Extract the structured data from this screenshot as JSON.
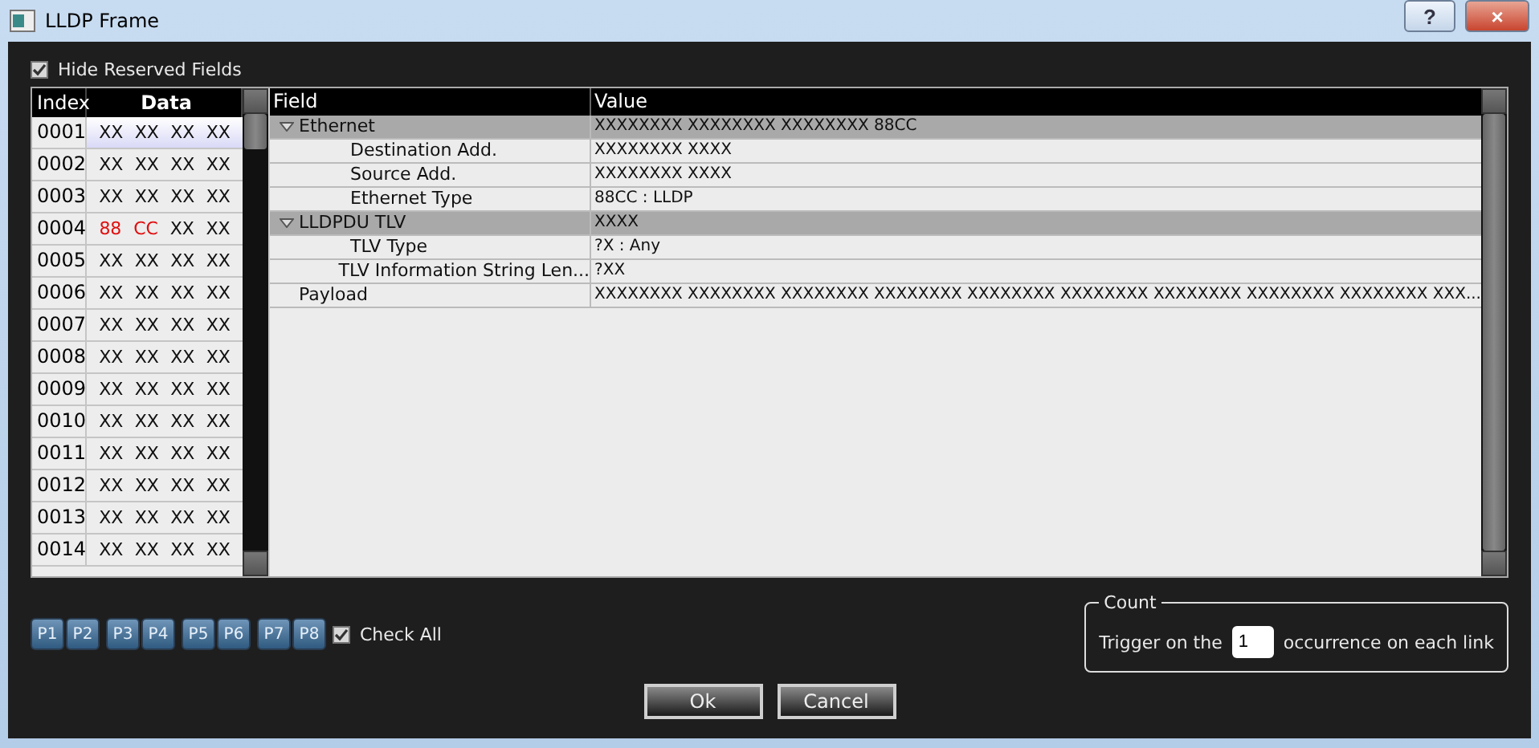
{
  "window": {
    "title": "LLDP Frame",
    "buttons": [
      "?",
      "×"
    ]
  },
  "hide_reserved": {
    "label": "Hide Reserved Fields",
    "checked": true
  },
  "data_table": {
    "columns": [
      "Index",
      "Data"
    ],
    "rows": [
      {
        "index": "0001",
        "selected": true,
        "cells": [
          {
            "text": "XX",
            "highlighted": false
          },
          {
            "text": "XX",
            "highlighted": false
          },
          {
            "text": "XX",
            "highlighted": false
          },
          {
            "text": "XX",
            "highlighted": false
          }
        ]
      },
      {
        "index": "0002",
        "selected": false,
        "cells": [
          {
            "text": "XX",
            "highlighted": false
          },
          {
            "text": "XX",
            "highlighted": false
          },
          {
            "text": "XX",
            "highlighted": false
          },
          {
            "text": "XX",
            "highlighted": false
          }
        ]
      },
      {
        "index": "0003",
        "selected": false,
        "cells": [
          {
            "text": "XX",
            "highlighted": false
          },
          {
            "text": "XX",
            "highlighted": false
          },
          {
            "text": "XX",
            "highlighted": false
          },
          {
            "text": "XX",
            "highlighted": false
          }
        ]
      },
      {
        "index": "0004",
        "selected": false,
        "cells": [
          {
            "text": "88",
            "highlighted": true
          },
          {
            "text": "CC",
            "highlighted": true
          },
          {
            "text": "XX",
            "highlighted": false
          },
          {
            "text": "XX",
            "highlighted": false
          }
        ]
      },
      {
        "index": "0005",
        "selected": false,
        "cells": [
          {
            "text": "XX",
            "highlighted": false
          },
          {
            "text": "XX",
            "highlighted": false
          },
          {
            "text": "XX",
            "highlighted": false
          },
          {
            "text": "XX",
            "highlighted": false
          }
        ]
      },
      {
        "index": "0006",
        "selected": false,
        "cells": [
          {
            "text": "XX",
            "highlighted": false
          },
          {
            "text": "XX",
            "highlighted": false
          },
          {
            "text": "XX",
            "highlighted": false
          },
          {
            "text": "XX",
            "highlighted": false
          }
        ]
      },
      {
        "index": "0007",
        "selected": false,
        "cells": [
          {
            "text": "XX",
            "highlighted": false
          },
          {
            "text": "XX",
            "highlighted": false
          },
          {
            "text": "XX",
            "highlighted": false
          },
          {
            "text": "XX",
            "highlighted": false
          }
        ]
      },
      {
        "index": "0008",
        "selected": false,
        "cells": [
          {
            "text": "XX",
            "highlighted": false
          },
          {
            "text": "XX",
            "highlighted": false
          },
          {
            "text": "XX",
            "highlighted": false
          },
          {
            "text": "XX",
            "highlighted": false
          }
        ]
      },
      {
        "index": "0009",
        "selected": false,
        "cells": [
          {
            "text": "XX",
            "highlighted": false
          },
          {
            "text": "XX",
            "highlighted": false
          },
          {
            "text": "XX",
            "highlighted": false
          },
          {
            "text": "XX",
            "highlighted": false
          }
        ]
      },
      {
        "index": "0010",
        "selected": false,
        "cells": [
          {
            "text": "XX",
            "highlighted": false
          },
          {
            "text": "XX",
            "highlighted": false
          },
          {
            "text": "XX",
            "highlighted": false
          },
          {
            "text": "XX",
            "highlighted": false
          }
        ]
      },
      {
        "index": "0011",
        "selected": false,
        "cells": [
          {
            "text": "XX",
            "highlighted": false
          },
          {
            "text": "XX",
            "highlighted": false
          },
          {
            "text": "XX",
            "highlighted": false
          },
          {
            "text": "XX",
            "highlighted": false
          }
        ]
      },
      {
        "index": "0012",
        "selected": false,
        "cells": [
          {
            "text": "XX",
            "highlighted": false
          },
          {
            "text": "XX",
            "highlighted": false
          },
          {
            "text": "XX",
            "highlighted": false
          },
          {
            "text": "XX",
            "highlighted": false
          }
        ]
      },
      {
        "index": "0013",
        "selected": false,
        "cells": [
          {
            "text": "XX",
            "highlighted": false
          },
          {
            "text": "XX",
            "highlighted": false
          },
          {
            "text": "XX",
            "highlighted": false
          },
          {
            "text": "XX",
            "highlighted": false
          }
        ]
      },
      {
        "index": "0014",
        "selected": false,
        "cells": [
          {
            "text": "XX",
            "highlighted": false
          },
          {
            "text": "XX",
            "highlighted": false
          },
          {
            "text": "XX",
            "highlighted": false
          },
          {
            "text": "XX",
            "highlighted": false
          }
        ]
      }
    ]
  },
  "field_tree": {
    "columns": [
      "Field",
      "Value"
    ],
    "nodes": [
      {
        "field": "Ethernet",
        "value": "XXXXXXXX XXXXXXXX XXXXXXXX 88CC",
        "expanded": true,
        "children": [
          {
            "field": "Destination Add.",
            "value": "XXXXXXXX XXXX"
          },
          {
            "field": "Source Add.",
            "value": "XXXXXXXX XXXX"
          },
          {
            "field": "Ethernet Type",
            "value": "88CC : LLDP"
          }
        ]
      },
      {
        "field": "LLDPDU TLV",
        "value": "XXXX",
        "expanded": true,
        "children": [
          {
            "field": "TLV Type",
            "value": "?X : Any"
          },
          {
            "field": "TLV Information String Len...",
            "value": "?XX"
          }
        ]
      },
      {
        "field": "Payload",
        "value": "XXXXXXXX XXXXXXXX XXXXXXXX XXXXXXXX XXXXXXXX XXXXXXXX XXXXXXXX XXXXXXXX XXXXXXXX XXX..."
      }
    ]
  },
  "ports": [
    [
      "P1",
      "P2"
    ],
    [
      "P3",
      "P4"
    ],
    [
      "P5",
      "P6"
    ],
    [
      "P7",
      "P8"
    ]
  ],
  "check_all": {
    "label": "Check All",
    "checked": true
  },
  "count": {
    "title": "Count",
    "prefix": "Trigger on the",
    "value": "1",
    "suffix": "occurrence on each link"
  },
  "buttons": [
    "Ok",
    "Cancel"
  ]
}
